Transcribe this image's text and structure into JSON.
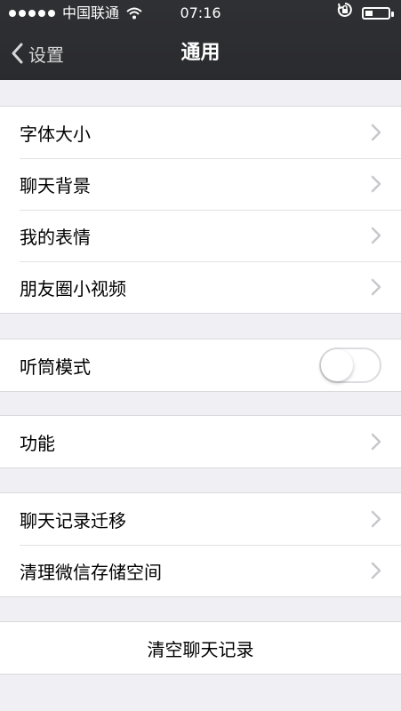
{
  "status_bar": {
    "carrier": "中国联通",
    "time": "07:16",
    "signal_dots": 5,
    "battery_fill": 0.35
  },
  "navbar": {
    "back_label": "设置",
    "title": "通用"
  },
  "groups": {
    "display": {
      "items": [
        {
          "label": "字体大小"
        },
        {
          "label": "聊天背景"
        },
        {
          "label": "我的表情"
        },
        {
          "label": "朋友圈小视频"
        }
      ]
    },
    "earpiece": {
      "label": "听筒模式",
      "enabled": false
    },
    "features": {
      "label": "功能"
    },
    "chat_records": {
      "items": [
        {
          "label": "聊天记录迁移"
        },
        {
          "label": "清理微信存储空间"
        }
      ]
    },
    "clear": {
      "label": "清空聊天记录"
    }
  },
  "icons": {
    "back": "chevron-left-icon",
    "row_arrow": "chevron-right-icon",
    "wifi": "wifi-icon",
    "orientation_lock": "rotation-lock-icon",
    "battery": "battery-icon"
  }
}
